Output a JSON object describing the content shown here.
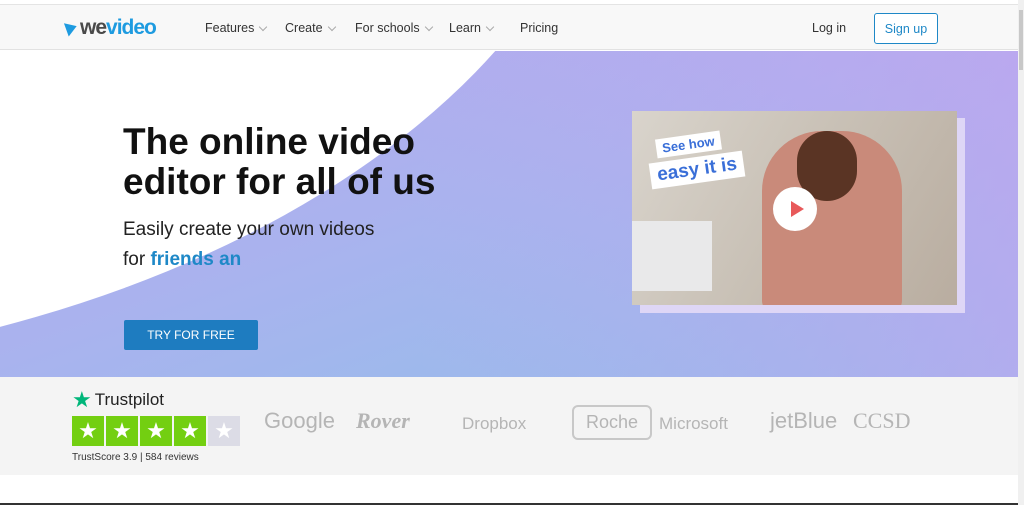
{
  "nav": {
    "logo": "wevideo",
    "items": [
      {
        "label": "Features",
        "dropdown": true
      },
      {
        "label": "Create",
        "dropdown": true
      },
      {
        "label": "For schools",
        "dropdown": true
      },
      {
        "label": "Learn",
        "dropdown": true
      },
      {
        "label": "Pricing",
        "dropdown": false
      }
    ],
    "login": "Log in",
    "signup": "Sign up"
  },
  "hero": {
    "title": "The online video editor for all of us",
    "subtitle_line1": "Easily create your own videos",
    "subtitle_prefix": "for ",
    "subtitle_highlight": "friends an",
    "cta": "TRY FOR FREE",
    "video_tag1": "See how",
    "video_tag2": "easy it is"
  },
  "trust": {
    "name": "Trustpilot",
    "rating_stars": 4,
    "score_label": "TrustScore 3.9",
    "reviews": "584 reviews"
  },
  "brands": [
    "Google",
    "Rover",
    "Dropbox",
    "Roche",
    "Microsoft",
    "jetBlue",
    "CCSD"
  ],
  "colors": {
    "accent": "#1e88c7",
    "trustpilot_green": "#73cf11"
  }
}
